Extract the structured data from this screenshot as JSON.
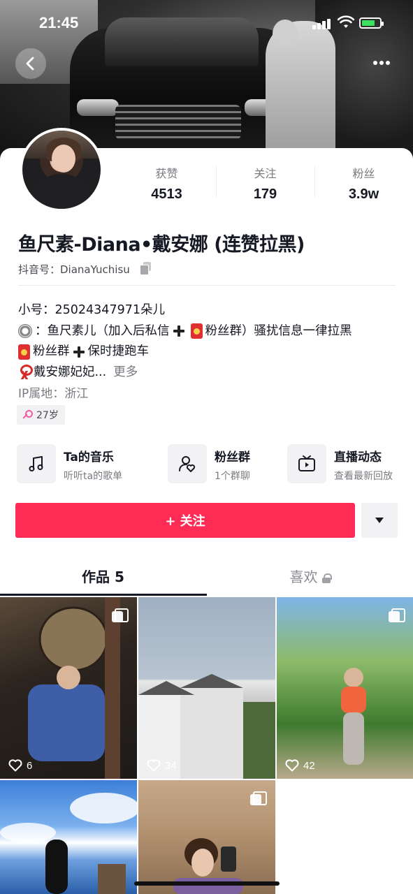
{
  "status_bar": {
    "time": "21:45"
  },
  "header": {
    "back_icon": "chevron-left-icon",
    "more_icon": "more-dots-icon"
  },
  "stats": [
    {
      "label": "获赞",
      "value": "4513"
    },
    {
      "label": "关注",
      "value": "179"
    },
    {
      "label": "粉丝",
      "value": "3.9w"
    }
  ],
  "profile": {
    "name": "鱼尺素-Diana•戴安娜 (连赞拉黑)",
    "douyin_id": "抖音号：DianaYuchisu",
    "bio": {
      "line1": "小号：25024347971朵儿",
      "line2_a": "：鱼尺素儿（加入后私信",
      "line2_b": "粉丝群）骚扰信息一律拉黑",
      "line3_a": "粉丝群",
      "line3_b": "保时捷跑车",
      "line4": "戴安娜妃妃...",
      "more": "更多"
    },
    "ip_location": "IP属地：浙江",
    "age": "27岁"
  },
  "services": [
    {
      "icon": "music-note-icon",
      "title": "Ta的音乐",
      "subtitle": "听听ta的歌单"
    },
    {
      "icon": "fan-group-icon",
      "title": "粉丝群",
      "subtitle": "1个群聊"
    },
    {
      "icon": "live-tv-icon",
      "title": "直播动态",
      "subtitle": "查看最新回放"
    }
  ],
  "actions": {
    "follow_label": "+ 关注"
  },
  "tabs": {
    "works": "作品 5",
    "likes": "喜欢"
  },
  "posts": [
    {
      "likes": "6",
      "multi": true
    },
    {
      "likes": "34",
      "multi": false
    },
    {
      "likes": "42",
      "multi": true
    },
    {
      "likes": "",
      "multi": false
    },
    {
      "likes": "",
      "multi": true
    }
  ],
  "colors": {
    "accent": "#fe2c55",
    "text_primary": "#161823",
    "text_secondary": "#7a7b80"
  }
}
